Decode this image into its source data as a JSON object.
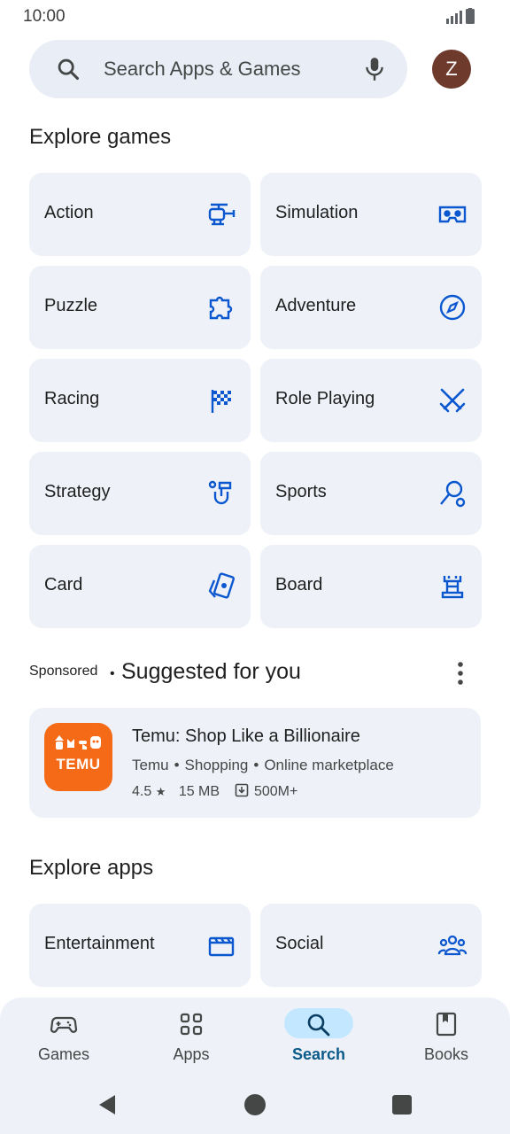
{
  "status_bar": {
    "time": "10:00"
  },
  "search": {
    "placeholder": "Search Apps & Games"
  },
  "account": {
    "initial": "Z",
    "color": "#6d3a2c"
  },
  "explore_games": {
    "title": "Explore games",
    "categories": [
      {
        "label": "Action",
        "icon": "helicopter-icon"
      },
      {
        "label": "Simulation",
        "icon": "vr-headset-icon"
      },
      {
        "label": "Puzzle",
        "icon": "puzzle-piece-icon"
      },
      {
        "label": "Adventure",
        "icon": "compass-icon"
      },
      {
        "label": "Racing",
        "icon": "checkered-flag-icon"
      },
      {
        "label": "Role Playing",
        "icon": "crossed-swords-icon"
      },
      {
        "label": "Strategy",
        "icon": "strategy-icon"
      },
      {
        "label": "Sports",
        "icon": "racket-icon"
      },
      {
        "label": "Card",
        "icon": "playing-card-icon"
      },
      {
        "label": "Board",
        "icon": "chess-rook-icon"
      }
    ]
  },
  "suggested": {
    "sponsored_label": "Sponsored",
    "separator": "•",
    "title": "Suggested for you",
    "app": {
      "name": "Temu: Shop Like a Billionaire",
      "icon_text": "TEMU",
      "developer": "Temu",
      "category": "Shopping",
      "subcategory": "Online marketplace",
      "rating": "4.5",
      "size": "15 MB",
      "downloads": "500M+",
      "icon_color": "#f46a16"
    }
  },
  "explore_apps": {
    "title": "Explore apps",
    "categories": [
      {
        "label": "Entertainment",
        "icon": "clapperboard-icon"
      },
      {
        "label": "Social",
        "icon": "people-icon"
      }
    ]
  },
  "bottom_nav": {
    "items": [
      {
        "label": "Games",
        "icon": "gamepad-icon"
      },
      {
        "label": "Apps",
        "icon": "apps-grid-icon"
      },
      {
        "label": "Search",
        "icon": "search-icon",
        "active": true
      },
      {
        "label": "Books",
        "icon": "bookmark-book-icon"
      }
    ]
  },
  "colors": {
    "accent": "#0b57d0",
    "tile_bg": "#eef2f8",
    "active_pill": "#c2e7ff"
  }
}
